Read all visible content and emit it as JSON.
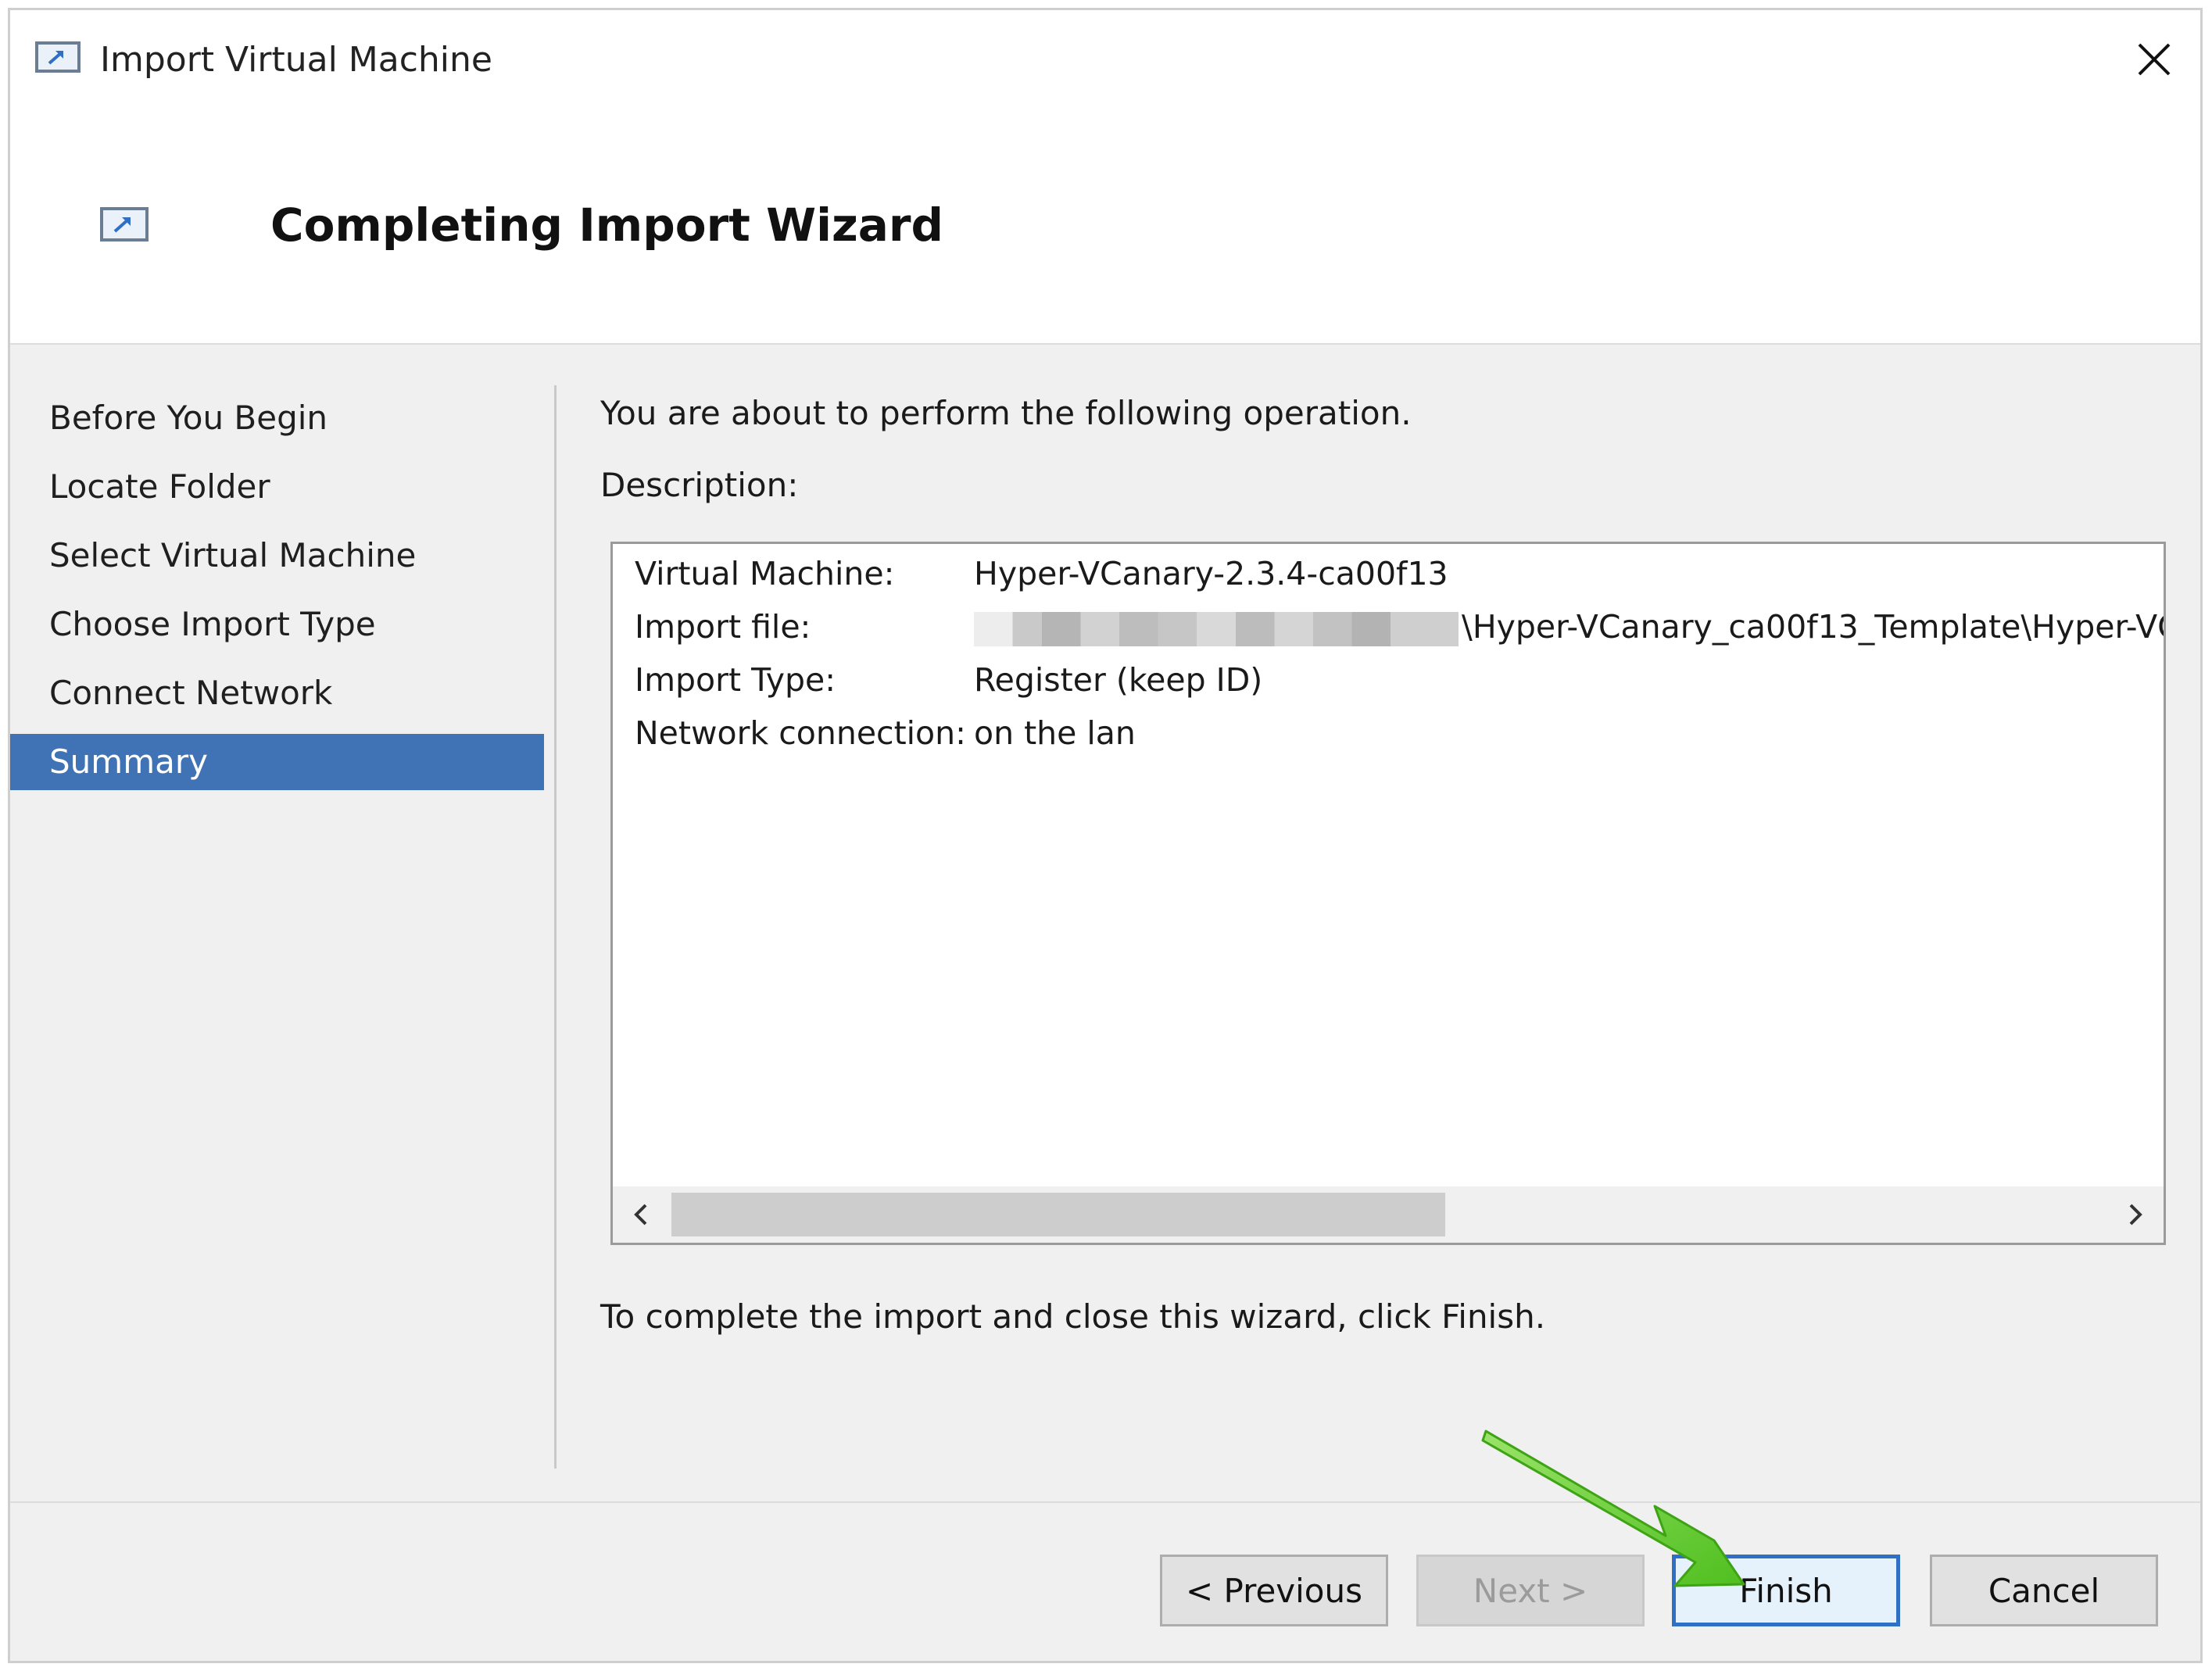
{
  "window": {
    "title": "Import Virtual Machine"
  },
  "header": {
    "title": "Completing Import Wizard"
  },
  "sidebar": {
    "items": [
      {
        "label": "Before You Begin"
      },
      {
        "label": "Locate Folder"
      },
      {
        "label": "Select Virtual Machine"
      },
      {
        "label": "Choose Import Type"
      },
      {
        "label": "Connect Network"
      },
      {
        "label": "Summary",
        "active": true
      }
    ]
  },
  "content": {
    "intro": "You are about to perform the following operation.",
    "description_label": "Description:",
    "rows": [
      {
        "key": "Virtual Machine:",
        "value": "Hyper-VCanary-2.3.4-ca00f13"
      },
      {
        "key": "Import file:",
        "value": "\\Hyper-VCanary_ca00f13_Template\\Hyper-VC",
        "redacted_prefix": true
      },
      {
        "key": "Import Type:",
        "value": "Register (keep ID)"
      },
      {
        "key": "Network connection:",
        "value": "on the lan"
      }
    ],
    "finish_note": "To complete the import and close this wizard, click Finish."
  },
  "buttons": {
    "previous": "< Previous",
    "next": "Next >",
    "finish": "Finish",
    "cancel": "Cancel"
  },
  "colors": {
    "active_nav_bg": "#3f73b5",
    "primary_button_border": "#2f6fc4",
    "annotation_arrow": "#66cc33"
  },
  "icons": {
    "window": "import-vm-icon",
    "close": "close-icon",
    "scroll_left": "chevron-left-icon",
    "scroll_right": "chevron-right-icon",
    "annotation": "green-arrow-icon"
  }
}
